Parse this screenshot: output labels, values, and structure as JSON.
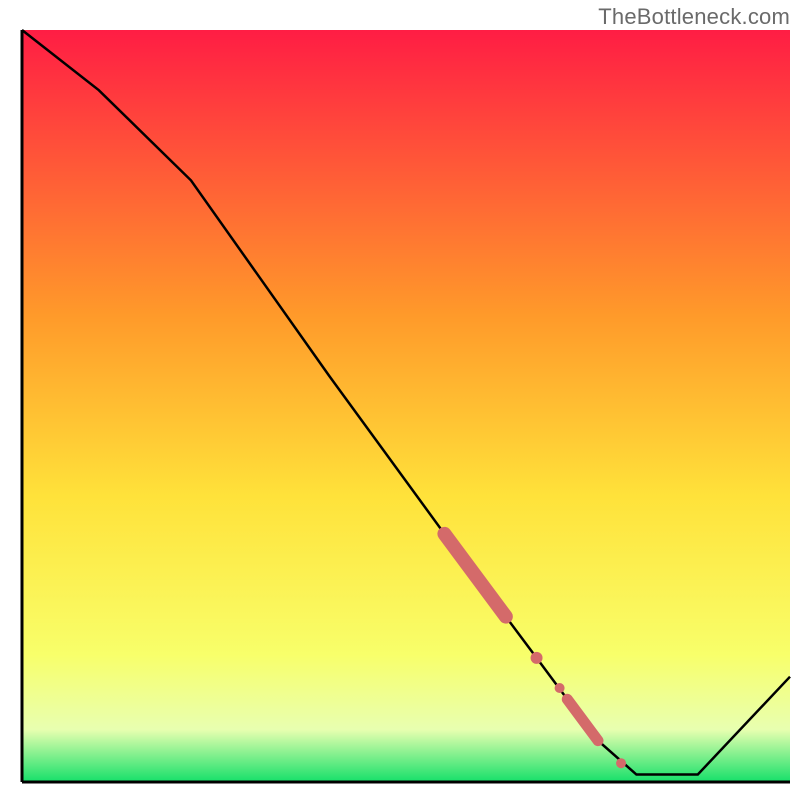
{
  "watermark": "TheBottleneck.com",
  "colors": {
    "axis": "#000000",
    "line": "#000000",
    "marker": "#d46a6a",
    "gradient_top": "#ff1d44",
    "gradient_mid1": "#ff9a2a",
    "gradient_mid2": "#ffe23a",
    "gradient_mid3": "#f8ff6a",
    "gradient_bottom": "#16e06a"
  },
  "chart_data": {
    "type": "line",
    "title": "",
    "xlabel": "",
    "ylabel": "",
    "xlim": [
      0,
      100
    ],
    "ylim": [
      0,
      100
    ],
    "series": [
      {
        "name": "curve",
        "x": [
          0,
          10,
          22,
          40,
          55,
          59,
          63,
          67,
          71,
          75,
          80,
          88,
          100
        ],
        "y": [
          100,
          92,
          80,
          54,
          33,
          27.5,
          22,
          16.5,
          11,
          5.5,
          1,
          1,
          14
        ]
      }
    ],
    "markers": [
      {
        "name": "thick-segment",
        "type": "segment",
        "x0": 55,
        "y0": 33,
        "x1": 63,
        "y1": 22,
        "width": 14
      },
      {
        "name": "dot-1",
        "type": "dot",
        "x": 67,
        "y": 16.5,
        "r": 6
      },
      {
        "name": "dot-2",
        "type": "dot",
        "x": 70,
        "y": 12.5,
        "r": 5
      },
      {
        "name": "thick-segment-2",
        "type": "segment",
        "x0": 71,
        "y0": 11,
        "x1": 75,
        "y1": 5.5,
        "width": 11
      },
      {
        "name": "dot-3",
        "type": "dot",
        "x": 78,
        "y": 2.5,
        "r": 5
      }
    ],
    "gradient_bands": [
      {
        "y": 100,
        "color": "gradient_top"
      },
      {
        "y": 60,
        "color": "gradient_mid1"
      },
      {
        "y": 35,
        "color": "gradient_mid2"
      },
      {
        "y": 15,
        "color": "gradient_mid3"
      },
      {
        "y": 0,
        "color": "gradient_bottom"
      }
    ]
  }
}
